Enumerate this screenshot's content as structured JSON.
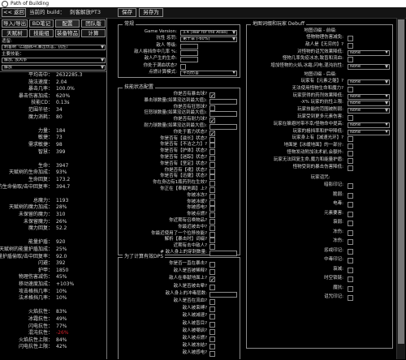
{
  "app": {
    "title": "Path of Building"
  },
  "topbar": {
    "back": "<< 返回",
    "build_label": "当前的 build：",
    "build_name": "刺客解放PT3",
    "save": "保存",
    "save_as": "另存为"
  },
  "left": {
    "import_export": "导入/导出",
    "notes": "BD笔记",
    "config": "配置",
    "party": "团队版",
    "tree": "天赋树",
    "skills": "技能组",
    "items": "装备物品",
    "calcs": "计算",
    "tree_label": "遗留:",
    "tree_value": "刺客树（凸面脉冲,暴击伤害，抗性）",
    "main_skill_label": "主要技能：",
    "main_skill_value": "解放, 放风筝",
    "sub_skill_value": "解放"
  },
  "stats": [
    {
      "k": "平均击中：",
      "v": "2632285.3"
    },
    {
      "k": "施法速度：",
      "v": "2.04"
    },
    {
      "k": "暴击几率：",
      "v": "100.0%"
    },
    {
      "k": "暴击伤害加成：",
      "v": "620%"
    },
    {
      "k": "技能CD：",
      "v": "0.13s"
    },
    {
      "k": "范围半径：",
      "v": "34"
    },
    {
      "k": "魔力消耗：",
      "v": "80"
    },
    {
      "k": "",
      "v": ""
    },
    {
      "k": "力量：",
      "v": "184"
    },
    {
      "k": "敏捷：",
      "v": "73"
    },
    {
      "k": "需求敏捷：",
      "v": "98"
    },
    {
      "k": "智慧：",
      "v": "399"
    },
    {
      "k": "",
      "v": ""
    },
    {
      "k": "生命：",
      "v": "3947"
    },
    {
      "k": "天赋树的生命加成：",
      "v": "93%"
    },
    {
      "k": "生命回复：",
      "v": "173.2"
    },
    {
      "k": "每秒的生命偷取/击中回复率：",
      "v": "394.7"
    },
    {
      "k": "",
      "v": ""
    },
    {
      "k": "总魔力：",
      "v": "1193"
    },
    {
      "k": "天赋树的魔力加成：",
      "v": "28%"
    },
    {
      "k": "未保留的魔力：",
      "v": "310"
    },
    {
      "k": "未保留魔力：",
      "v": "26%"
    },
    {
      "k": "魔力回复：",
      "v": "52.2"
    },
    {
      "k": "",
      "v": ""
    },
    {
      "k": "能量护盾：",
      "v": "920"
    },
    {
      "k": "天赋树的能量护盾加成：",
      "v": "25%"
    },
    {
      "k": "每秒能量护盾偷取/击中回复率：",
      "v": "92.0"
    },
    {
      "k": "闪避：",
      "v": "392"
    },
    {
      "k": "护甲：",
      "v": "1850"
    },
    {
      "k": "物理伤害减伤：",
      "v": "45%"
    },
    {
      "k": "移动速度加成：",
      "v": "+103%"
    },
    {
      "k": "攻击格挡几率：",
      "v": "10%"
    },
    {
      "k": "法术格挡几率：",
      "v": "10%"
    },
    {
      "k": "",
      "v": ""
    },
    {
      "k": "火焰抗性：",
      "v": "83%"
    },
    {
      "k": "冰霜抗性：",
      "v": "49%"
    },
    {
      "k": "闪电抗性：",
      "v": "77%"
    },
    {
      "k": "混沌抗性：",
      "v": "-26%"
    },
    {
      "k": "火焰抗性上限：",
      "v": "84%"
    },
    {
      "k": "闪电抗性上限：",
      "v": "42%"
    }
  ],
  "general": {
    "title": "常规",
    "rows": [
      {
        "k": "Game Version:",
        "combo": "3.4 (War for the Atlas)"
      },
      {
        "k": "抗性 惩罚:",
        "combo": "第十章 (-60%)"
      },
      {
        "k": "敌人 等级:",
        "inp": true
      },
      {
        "k": "敌人格挡命中几率 %:",
        "inp": true
      },
      {
        "k": "敌人产生的生命:",
        "inp": true
      },
      {
        "k": "你处于满血状态?",
        "cb": ""
      },
      {
        "k": "点燃计算模式:",
        "combo": "平均伤害"
      }
    ]
  },
  "skill": {
    "title": "技能状态配置",
    "rows": [
      {
        "k": "你是否有暴击球?",
        "cb": "✓"
      },
      {
        "k": "暴击球数量(如果没达到最大值):",
        "inp": true
      },
      {
        "k": "你是否有狂怒球?",
        "cb": ""
      },
      {
        "k": "狂怒球数量(如果没达到最大值):",
        "inp": true
      },
      {
        "k": "你是否有耐力球?",
        "cb": "✓"
      },
      {
        "k": "耐力球数量(如果没达到最大值):",
        "inp": true
      },
      {
        "k": "你处于蓄力状态?",
        "cb": "✓"
      },
      {
        "k": "你是否有【滋长】状态?",
        "cb": ""
      },
      {
        "k": "你是否有【不洁之力】?",
        "cb": ""
      },
      {
        "k": "你是否有【护体】状态?",
        "cb": ""
      },
      {
        "k": "你是否有【迷踪】状态?",
        "cb": ""
      },
      {
        "k": "你是否有【坚定】状态?",
        "cb": ""
      },
      {
        "k": "你是否有【魂】状态?",
        "cb": ""
      },
      {
        "k": "你是否有【迅捷】状态?",
        "cb": ""
      },
      {
        "k": "你在身边有1瓶药剂在生效?",
        "cb": ""
      },
      {
        "k": "你正在【奉献地面】上?",
        "cb": ""
      },
      {
        "k": "你被冰冻?",
        "cb": ""
      },
      {
        "k": "你被冰缓?",
        "cb": ""
      },
      {
        "k": "你被感电?",
        "cb": ""
      },
      {
        "k": "你被点燃?",
        "cb": ""
      },
      {
        "k": "你近期有召唤物品?",
        "cb": ""
      },
      {
        "k": "你最近被击中?",
        "cb": ""
      },
      {
        "k": "你最近使用了一个位移技能?",
        "cb": ""
      },
      {
        "k": "解析【暴击时】词缀?",
        "cb": ""
      },
      {
        "k": "近期有击中敌人?",
        "cb": ""
      },
      {
        "k": "# 敌人身上的穿刺数量:",
        "inp": true
      }
    ]
  },
  "dps": {
    "title": "为了计算有效DPS",
    "rows": [
      {
        "k": "你是否一直在暴击?",
        "cb": ""
      },
      {
        "k": "敌人是否被稀释?",
        "cb": ""
      },
      {
        "k": "敌人在奉献地面上?",
        "cb": "✓"
      },
      {
        "k": "敌人是否被击晕?",
        "cb": ""
      },
      {
        "k": "敌人身上的冲毒层数:",
        "inp": true
      },
      {
        "k": "敌人是否在流血?",
        "cb": ""
      },
      {
        "k": "敌人被束缚?",
        "cb": ""
      },
      {
        "k": "敌人被减速?",
        "cb": ""
      },
      {
        "k": "敌人被盲目?",
        "cb": ""
      },
      {
        "k": "敌人被嘲讽?",
        "cb": ""
      },
      {
        "k": "敌人被点燃?",
        "cb": ""
      },
      {
        "k": "敌人被冻结?",
        "cb": ""
      },
      {
        "k": "敌人被感电?",
        "cb": ""
      }
    ]
  },
  "map": {
    "title": "地图词缀和玩家 Debuff",
    "heading": "地图词缀 - 前缀:",
    "rows": [
      {
        "k": "怪物物理伤害减免:",
        "cb": ""
      },
      {
        "k": "敌人是【无穷的】?",
        "cb": ""
      },
      {
        "k": "对怪物的诅咒效果降低:",
        "combo": "None"
      },
      {
        "k": "怪物几率免疫冰冻,致盲和流血:",
        "cb": ""
      },
      {
        "k": "增加怪物的火焰,冰霜,闪电,混沌抗性:",
        "combo": "None"
      }
    ],
    "heading2": "地图词缀 - 后缀:",
    "rows2": [
      {
        "k": "玩家有【元素之躯】?",
        "combo": "None"
      },
      {
        "k": "无法使用怪物生命和魔力?",
        "cb": ""
      },
      {
        "k": "玩家获得的药剂效果降低:",
        "combo": "None"
      },
      {
        "k": "-X% 玩家的抗性上限:",
        "combo": "None"
      },
      {
        "k": "玩家技能的范围被削弱:",
        "combo": "None"
      },
      {
        "k": "玩家受到更多元素伤害:",
        "cb": ""
      },
      {
        "k": "玩家在躲避时带不幸/怪物命中提高:",
        "combo": "None"
      },
      {
        "k": "玩家的格挡率和护甲降低:",
        "combo": "None"
      },
      {
        "k": "玩家身上有【减速光环】?",
        "cb": ""
      },
      {
        "k": "地面是【冰缓地面】的一部分:",
        "cb": ""
      },
      {
        "k": "怪物发动附加法术前,会额外:",
        "cb": ""
      },
      {
        "k": "玩家无法回复生命,魔力和能量护盾:",
        "cb": ""
      },
      {
        "k": "怪物受到的暴击伤害降低:",
        "cb": ""
      }
    ],
    "heading3": "玩家诅咒:",
    "curses": [
      {
        "k": "暗影印记:",
        "cb": ""
      },
      {
        "k": "脆弱:",
        "cb": ""
      },
      {
        "k": "电毒:",
        "cb": ""
      },
      {
        "k": "元素要害:",
        "cb": ""
      },
      {
        "k": "衰弱:",
        "cb": ""
      },
      {
        "k": "冻伤:",
        "cb": ""
      },
      {
        "k": "冻伤:",
        "cb": ""
      },
      {
        "k": "惩戒印记:",
        "cb": ""
      },
      {
        "k": "中毒印记:",
        "cb": ""
      },
      {
        "k": "衰减:",
        "cb": ""
      },
      {
        "k": "时空锁链:",
        "cb": ""
      },
      {
        "k": "魔抗:",
        "cb": ""
      },
      {
        "k": "诅咒印记:",
        "cb": ""
      }
    ]
  },
  "colors": {
    "chaos": "#d0202a"
  }
}
